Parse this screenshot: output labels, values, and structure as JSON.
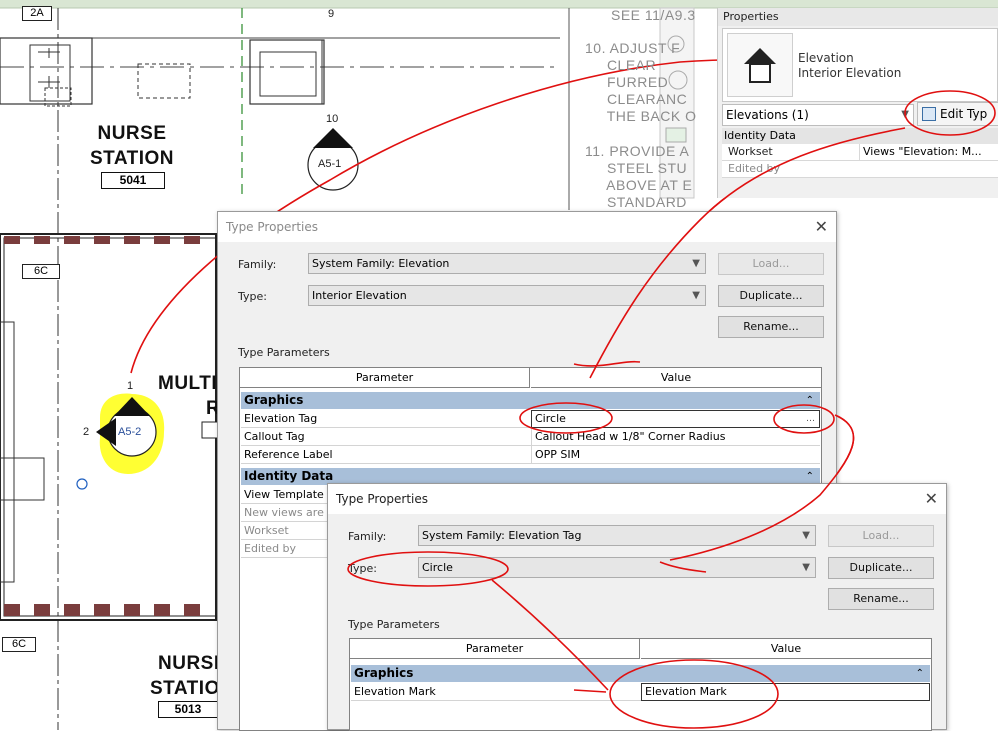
{
  "drawing": {
    "grid_tag_top": "2A",
    "grid_number_9": "9",
    "grid_tag_6c_upper": "6C",
    "grid_tag_6c_lower": "6C",
    "rooms": [
      {
        "name_line1": "NURSE",
        "name_line2": "STATION",
        "number": "5041"
      },
      {
        "name_line1": "MULTI",
        "name_line2": "R",
        "number": ""
      },
      {
        "name_line1": "NURSE",
        "name_line2": "STATIO",
        "number": "5013"
      }
    ],
    "elev_marker_upper": {
      "number": "10",
      "sheet": "A5-1"
    },
    "elev_marker_lower": {
      "number": "1",
      "sheet": "A5-2",
      "side": "2"
    },
    "notes": [
      "SEE 11/A9.3",
      "10. ADJUST F\n     CLEAR\n     FURRED\n     CLEARANC\n     THE BACK O",
      "11. PROVIDE A\n     STEEL STU\n     ABOVE AT E\n     STANDARD"
    ]
  },
  "properties_palette": {
    "title": "Properties",
    "type_category": "Elevation",
    "type_name": "Interior Elevation",
    "selector": "Elevations (1)",
    "edit_type": "Edit Typ",
    "group": "Identity Data",
    "rows": [
      {
        "key": "Workset",
        "value": "Views \"Elevation: M..."
      },
      {
        "key": "Edited by",
        "value": ""
      }
    ]
  },
  "dialog_elevation": {
    "title": "Type Properties",
    "family_label": "Family:",
    "family_value": "System Family: Elevation",
    "type_label": "Type:",
    "type_value": "Interior Elevation",
    "load_btn": "Load...",
    "duplicate_btn": "Duplicate...",
    "rename_btn": "Rename...",
    "section_label": "Type Parameters",
    "col_param": "Parameter",
    "col_value": "Value",
    "group_graphics": "Graphics",
    "rows_graphics": [
      {
        "param": "Elevation Tag",
        "value": "Circle"
      },
      {
        "param": "Callout Tag",
        "value": "Callout Head w 1/8\" Corner Radius"
      },
      {
        "param": "Reference Label",
        "value": "OPP SIM"
      }
    ],
    "group_identity": "Identity Data",
    "rows_identity": [
      {
        "param": "View Template a"
      },
      {
        "param": "New views are d"
      },
      {
        "param": "Workset"
      },
      {
        "param": "Edited by"
      }
    ]
  },
  "dialog_elevation_tag": {
    "title": "Type Properties",
    "family_label": "Family:",
    "family_value": "System Family: Elevation Tag",
    "type_label": "Type:",
    "type_value": "Circle",
    "load_btn": "Load...",
    "duplicate_btn": "Duplicate...",
    "rename_btn": "Rename...",
    "section_label": "Type Parameters",
    "col_param": "Parameter",
    "col_value": "Value",
    "group_graphics": "Graphics",
    "rows": [
      {
        "param": "Elevation Mark",
        "value": "Elevation Mark"
      }
    ]
  },
  "colors": {
    "annotation_red": "#e01010",
    "highlight_yellow": "#ffff33",
    "group_header_blue": "#a8bfd9",
    "hatch_brown": "#7a3d3d"
  }
}
